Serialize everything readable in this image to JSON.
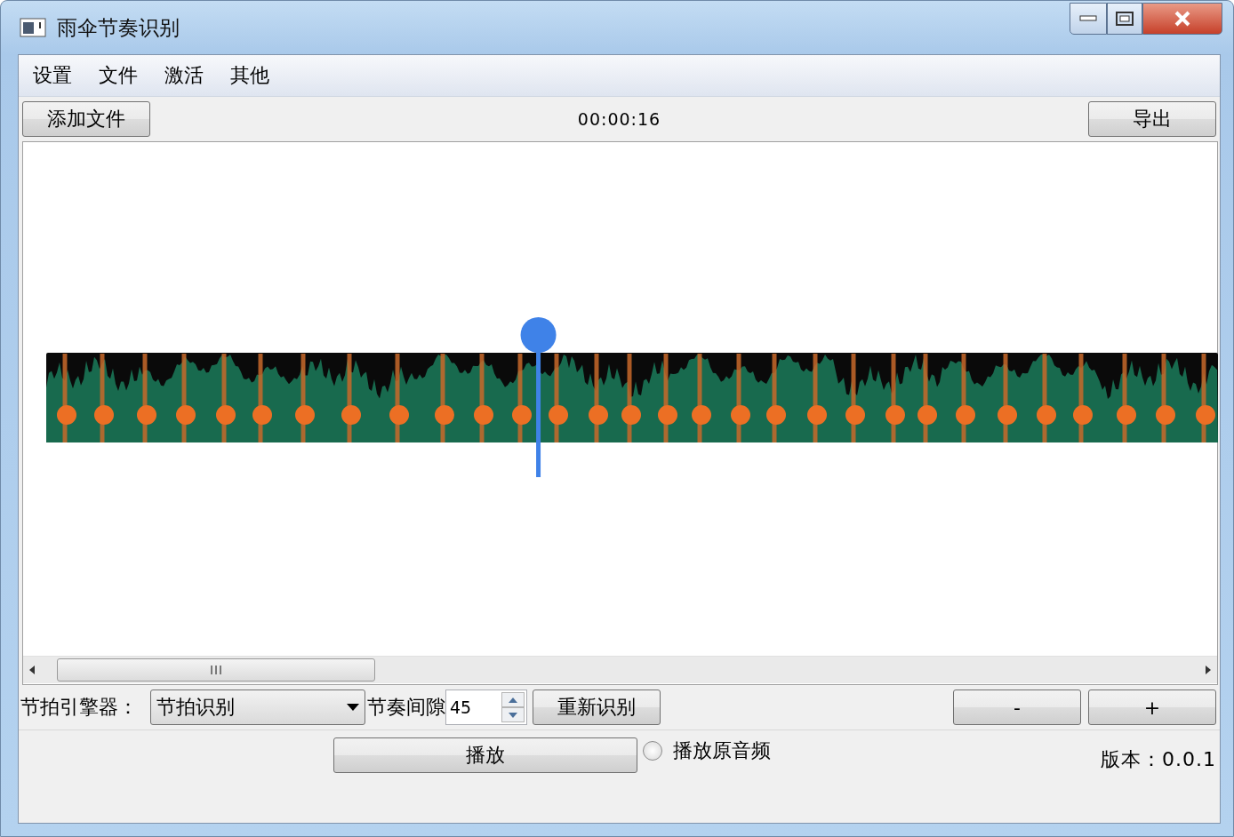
{
  "window": {
    "title": "雨伞节奏识别"
  },
  "menu": [
    {
      "label": "设置"
    },
    {
      "label": "文件"
    },
    {
      "label": "激活"
    },
    {
      "label": "其他"
    }
  ],
  "toolbar": {
    "add_button": "添加文件",
    "time": "00:00:16",
    "export_button": "导出"
  },
  "waveform": {
    "playhead": {
      "level": 0.42
    }
  },
  "controls": {
    "engine_label": "节拍引擎器：",
    "engine_value": "节拍识别",
    "interval_label": "节奏间隙",
    "interval_value": "45",
    "redetect_button": "重新识别",
    "minus_button": "-",
    "plus_button": "+"
  },
  "footer": {
    "play_button": "播放",
    "original_audio": {
      "label": "播放原音频",
      "checked": false
    },
    "version": "版本：0.0.1"
  }
}
